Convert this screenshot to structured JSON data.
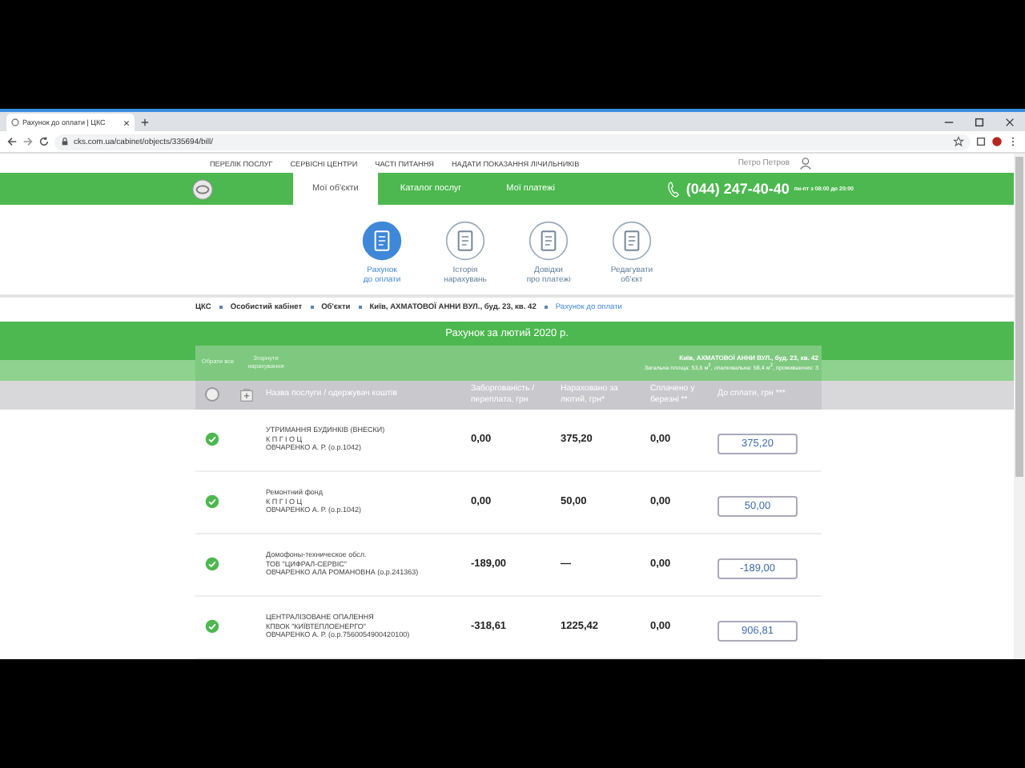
{
  "browser": {
    "tab_title": "Рахунок до оплати | ЦКС",
    "url": "cks.com.ua/cabinet/objects/335694/bill/"
  },
  "top_nav": {
    "links": [
      "ПЕРЕЛІК ПОСЛУГ",
      "СЕРВІСНІ ЦЕНТРИ",
      "ЧАСТІ ПИТАННЯ",
      "НАДАТИ ПОКАЗАННЯ ЛІЧИЛЬНИКІВ"
    ],
    "user_name": "Петро Петров"
  },
  "main_nav": {
    "tabs": [
      {
        "label": "Мої об'єкти",
        "selected": true
      },
      {
        "label": "Каталог послуг",
        "selected": false
      },
      {
        "label": "Мої платежі",
        "selected": false
      }
    ],
    "phone": "(044) 247-40-40",
    "hours": "пн-пт з 08:00 до 20:00"
  },
  "actions": [
    {
      "label": "Рахунок\nдо оплати",
      "selected": true
    },
    {
      "label": "Історія\nнарахувань",
      "selected": false
    },
    {
      "label": "Довідки\nпро платежі",
      "selected": false
    },
    {
      "label": "Редагувати\nоб'єкт",
      "selected": false
    }
  ],
  "breadcrumb": [
    {
      "label": "ЦКС",
      "current": false
    },
    {
      "label": "Особистий кабінет",
      "current": false
    },
    {
      "label": "Об'єкти",
      "current": false
    },
    {
      "label": "Київ, АХМАТОВОЇ АННИ ВУЛ., буд. 23, кв. 42",
      "current": false
    },
    {
      "label": "Рахунок до оплати",
      "current": true
    }
  ],
  "bill": {
    "title": "Рахунок за лютий 2020 р.",
    "select_all": "Обрати все",
    "collapse": "Згорнути нарахування",
    "address": "Київ, АХМАТОВОЇ АННИ ВУЛ., буд. 23, кв. 42",
    "area": "Загальна площа: 53,6 м$^{2}$, опалювальна: 58,4 м$^{2}$, проживаючих: 3",
    "header_checked": false,
    "columns": [
      "Назва послуги / одержувач коштів",
      "Заборгованість / переплата, грн",
      "Нараховано за лютий, грн*",
      "Сплачено у березні **",
      "До сплати, грн ***"
    ],
    "rows": [
      {
        "checked": true,
        "name": [
          "УТРИМАННЯ БУДИНКІВ (ВНЕСКИ)",
          "К П Г І О Ц",
          "ОВЧАРЕНКО А. Р. (о.р.1042)"
        ],
        "debt": "0,00",
        "accrued": "375,20",
        "paid": "0,00",
        "to_pay": "375,20"
      },
      {
        "checked": true,
        "name": [
          "Ремонтний фонд",
          "К П Г І О Ц",
          "ОВЧАРЕНКО А. Р. (о.р.1042)"
        ],
        "debt": "0,00",
        "accrued": "50,00",
        "paid": "0,00",
        "to_pay": "50,00"
      },
      {
        "checked": true,
        "name": [
          "Домофоны-техническое обсл.",
          "ТОВ \"ЦИФРАЛ-СЕРВІС\"",
          "ОВЧАРЕНКО АЛА РОМАНОВНА (о.р.241363)"
        ],
        "debt": "-189,00",
        "accrued": "—",
        "paid": "0,00",
        "to_pay": "-189,00"
      },
      {
        "checked": true,
        "name": [
          "ЦЕНТРАЛІЗОВАНЕ ОПАЛЕННЯ",
          "КПВОК \"КИЇВТЕПЛОЕНЕРГО\"",
          "ОВЧАРЕНКО А. Р. (о.р.7560054900420100)"
        ],
        "debt": "-318,61",
        "accrued": "1225,42",
        "paid": "0,00",
        "to_pay": "906,81"
      }
    ]
  }
}
